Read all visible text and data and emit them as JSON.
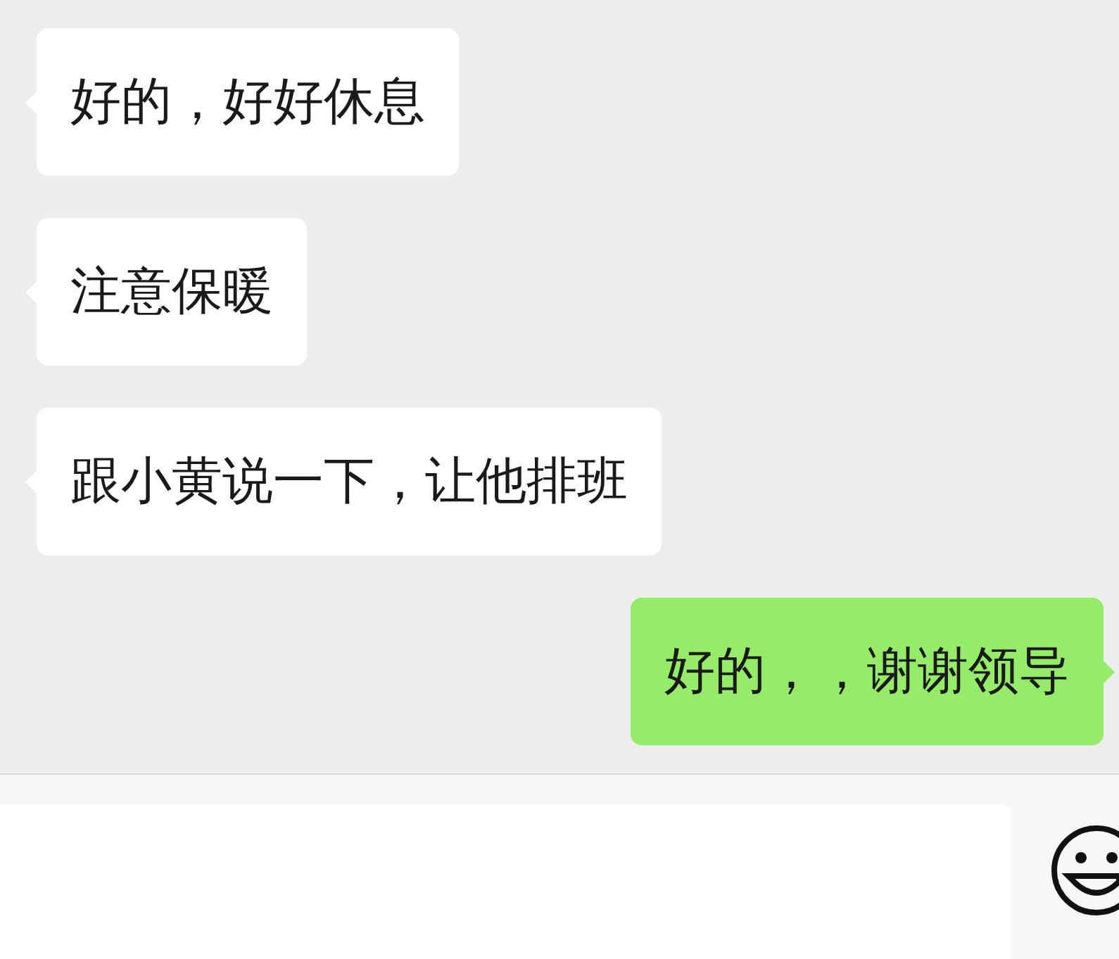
{
  "messages": [
    {
      "kind": "received",
      "text": "好的，好好休息"
    },
    {
      "kind": "received",
      "text": "注意保暖"
    },
    {
      "kind": "received",
      "text": "跟小黄说一下，让他排班"
    },
    {
      "kind": "sent",
      "text": "好的，，谢谢领导"
    }
  ]
}
